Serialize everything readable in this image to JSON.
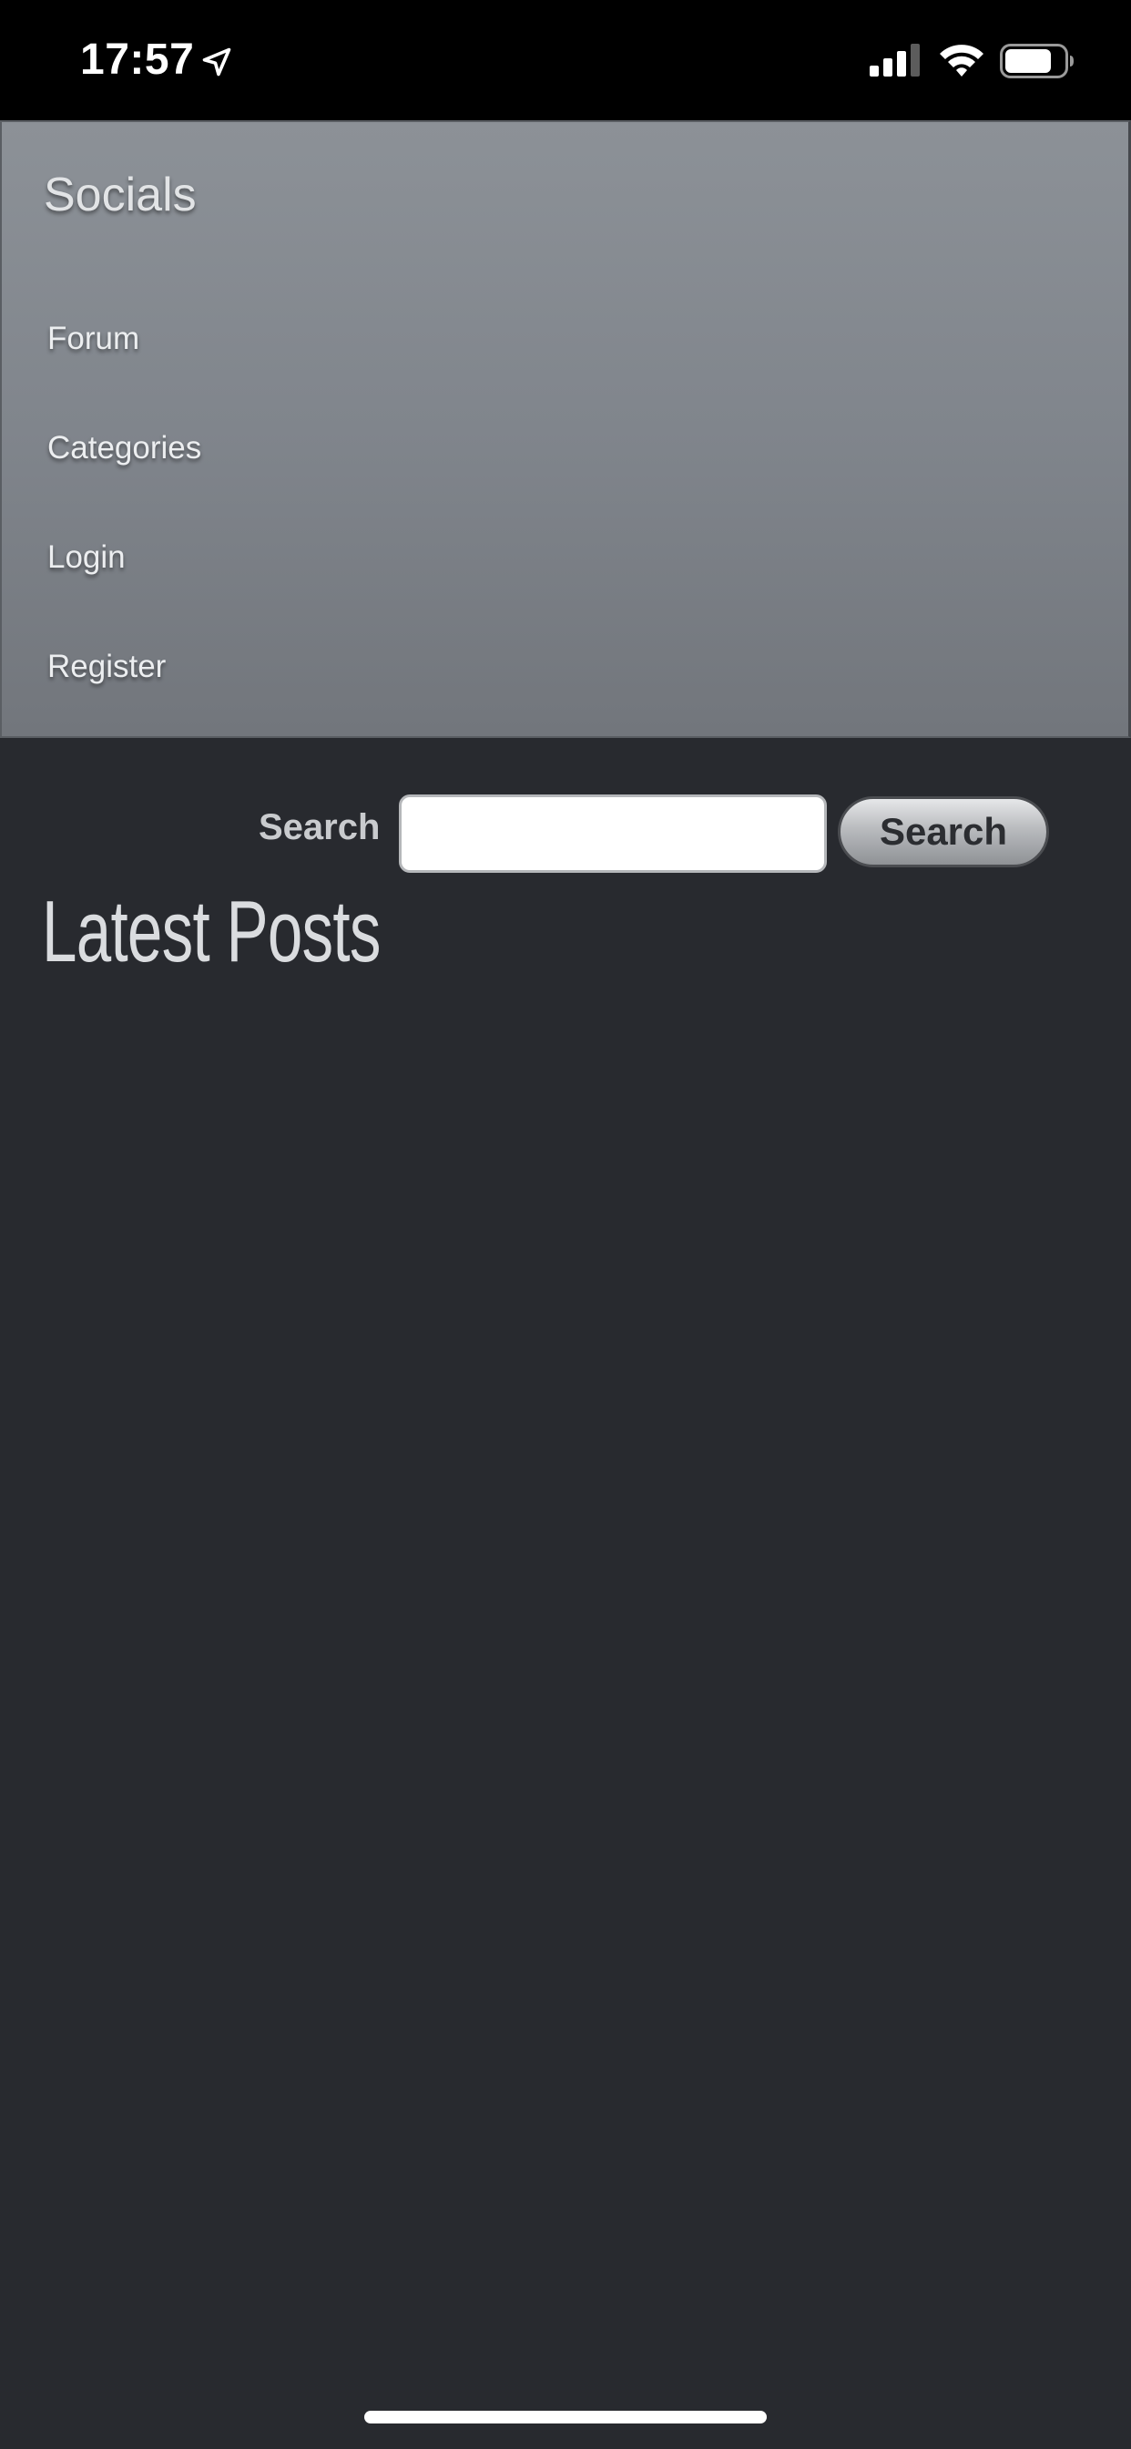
{
  "status_bar": {
    "time": "17:57",
    "icons": [
      "location-arrow-icon",
      "cellular-signal-icon",
      "wifi-icon",
      "battery-icon"
    ]
  },
  "nav": {
    "title": "Socials",
    "items": [
      {
        "label": "Forum"
      },
      {
        "label": "Categories"
      },
      {
        "label": "Login"
      },
      {
        "label": "Register"
      }
    ]
  },
  "search": {
    "label": "Search",
    "value": "",
    "button_label": "Search"
  },
  "main": {
    "heading": "Latest Posts"
  },
  "colors": {
    "background": "#282a2f",
    "status_bar": "#000000",
    "nav_panel_top": "#8c9197",
    "nav_panel_bottom": "#72767c",
    "text_light": "#dadcdf"
  }
}
